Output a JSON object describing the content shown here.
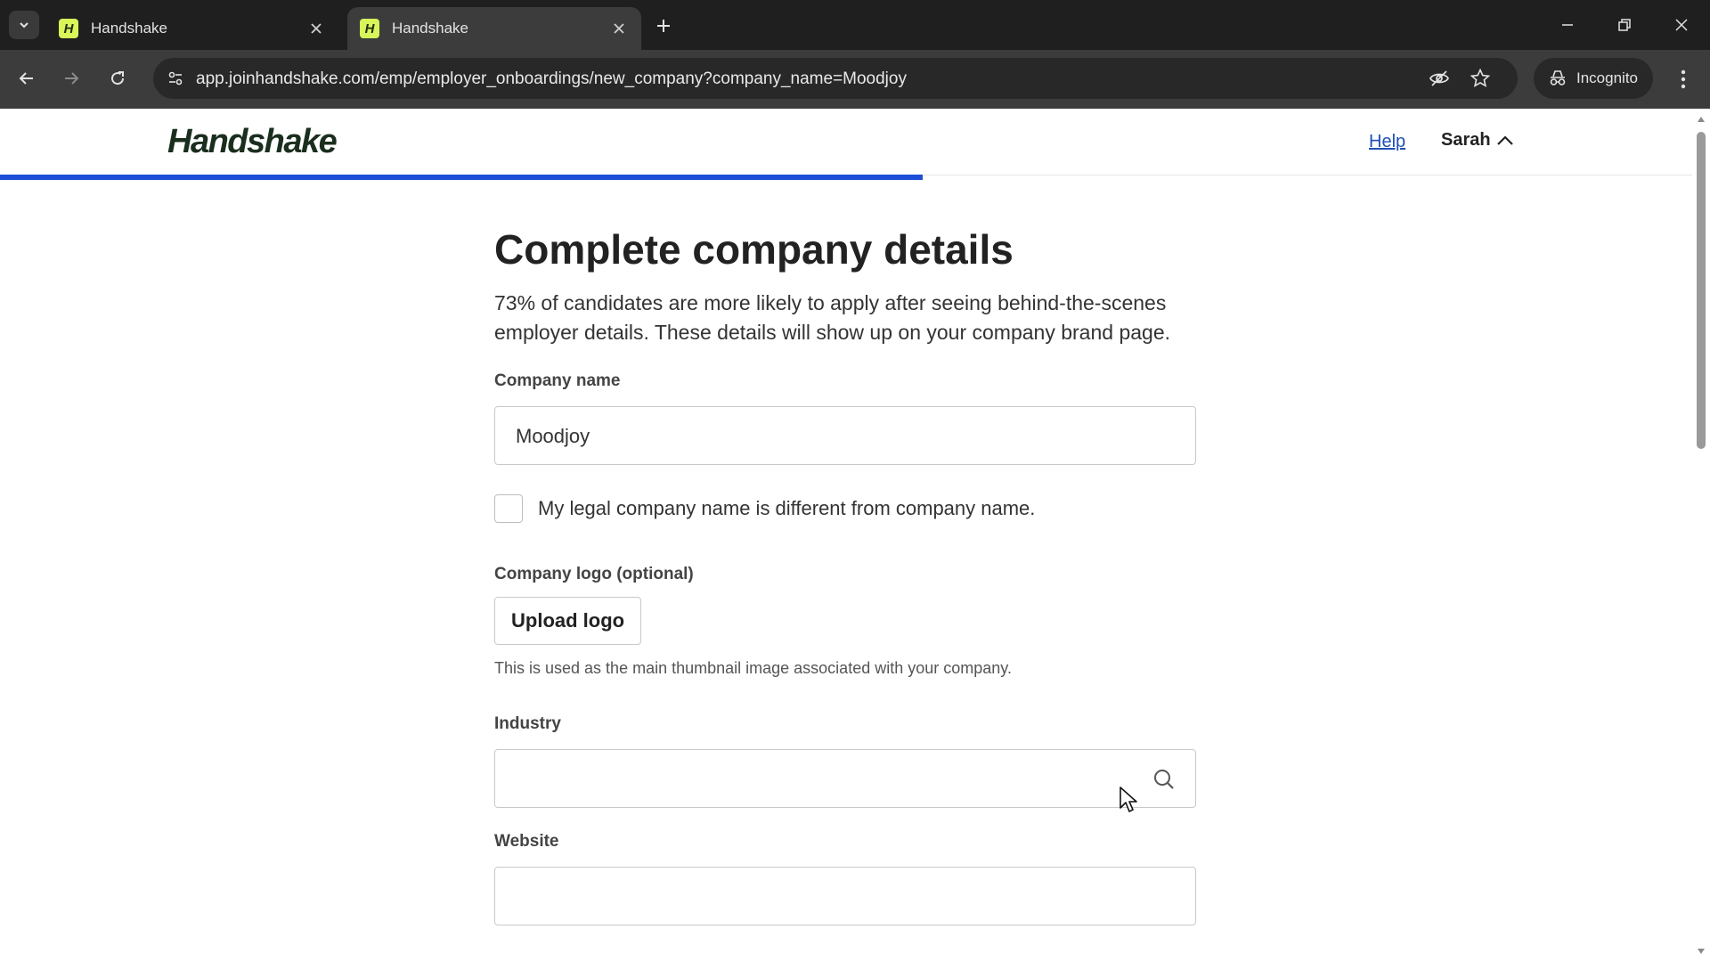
{
  "browser": {
    "tabs": [
      {
        "title": "Handshake",
        "favicon": "H",
        "active": false
      },
      {
        "title": "Handshake",
        "favicon": "H",
        "active": true
      }
    ],
    "url": "app.joinhandshake.com/emp/employer_onboardings/new_company?company_name=Moodjoy",
    "incognito_label": "Incognito"
  },
  "header": {
    "logo": "Handshake",
    "help_link": "Help",
    "user_name": "Sarah"
  },
  "onboarding": {
    "progress": 0.545,
    "progress_color": "#1d4ed8"
  },
  "form": {
    "title": "Complete company details",
    "intro": "73% of candidates are more likely to apply after seeing behind-the-scenes employer details. These details will show up on your company brand page.",
    "company_name": {
      "label": "Company name",
      "value": "Moodjoy"
    },
    "legal_name_checkbox": {
      "label": "My legal company name is different from company name.",
      "checked": false
    },
    "logo": {
      "label": "Company logo (optional)",
      "button": "Upload logo",
      "hint": "This is used as the main thumbnail image associated with your company."
    },
    "industry": {
      "label": "Industry",
      "value": ""
    },
    "website": {
      "label": "Website"
    }
  },
  "colors": {
    "tab_strip": "#1f1f1f",
    "toolbar": "#3c3c3c",
    "link": "#1f4fb5",
    "favicon_bg": "#d8f55a"
  }
}
